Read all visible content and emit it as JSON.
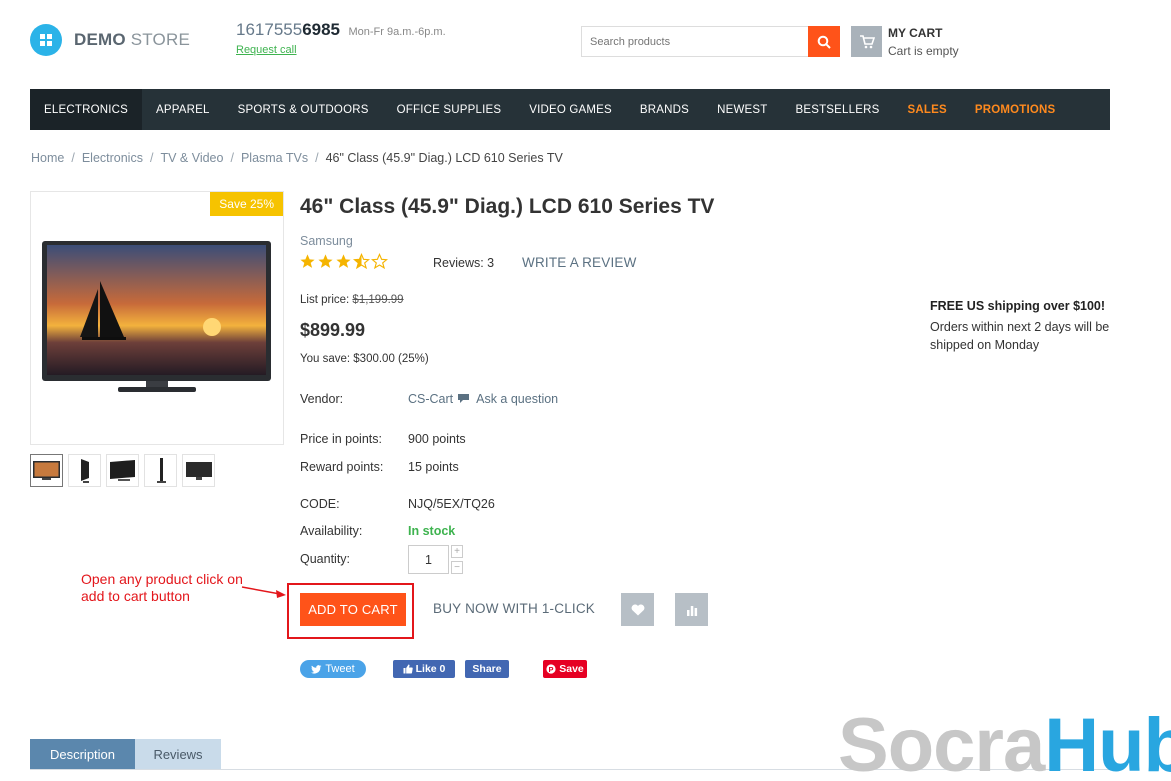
{
  "header": {
    "logo_bold": "DEMO",
    "logo_light": " STORE",
    "phone_prefix": "1617555",
    "phone_suffix": "6985",
    "hours": "Mon-Fr 9a.m.-6p.m.",
    "request_call": "Request call",
    "search_placeholder": "Search products",
    "cart_title": "MY CART",
    "cart_status": "Cart is empty"
  },
  "nav": {
    "items": [
      {
        "label": "ELECTRONICS"
      },
      {
        "label": "APPAREL"
      },
      {
        "label": "SPORTS & OUTDOORS"
      },
      {
        "label": "OFFICE SUPPLIES"
      },
      {
        "label": "VIDEO GAMES"
      },
      {
        "label": "BRANDS"
      },
      {
        "label": "NEWEST"
      },
      {
        "label": "BESTSELLERS"
      },
      {
        "label": "SALES"
      },
      {
        "label": "PROMOTIONS"
      }
    ]
  },
  "breadcrumb": {
    "items": [
      "Home",
      "Electronics",
      "TV & Video",
      "Plasma TVs"
    ],
    "current": "46\" Class (45.9\" Diag.) LCD 610 Series TV"
  },
  "product": {
    "save_badge": "Save 25%",
    "title": "46\" Class (45.9\" Diag.) LCD 610 Series TV",
    "brand": "Samsung",
    "rating": 3.5,
    "reviews_text": "Reviews: 3",
    "write_review": "WRITE A REVIEW",
    "list_price_label": "List price:",
    "list_price": "$1,199.99",
    "price": "$899.99",
    "you_save": "You save: $300.00 (25%)",
    "vendor_label": "Vendor:",
    "vendor": "CS-Cart",
    "ask_question": "Ask a question",
    "points_label": "Price in points:",
    "points": "900 points",
    "reward_label": "Reward points:",
    "reward": "15 points",
    "code_label": "CODE:",
    "code": "NJQ/5EX/TQ26",
    "availability_label": "Availability:",
    "availability": "In stock",
    "quantity_label": "Quantity:",
    "quantity": "1",
    "qty_plus": "+",
    "qty_minus": "−",
    "add_to_cart": "ADD TO CART",
    "buy_now": "BUY NOW WITH 1-CLICK"
  },
  "shipping": {
    "heading": "FREE US shipping over $100!",
    "text": "Orders within next 2 days will be shipped on Monday"
  },
  "annotation": {
    "text": "Open any product click on add to cart button",
    "color": "#e3161b"
  },
  "social": {
    "tweet": "Tweet",
    "like": "Like 0",
    "share": "Share",
    "save": "Save"
  },
  "tabs": {
    "description": "Description",
    "reviews": "Reviews"
  },
  "watermark": {
    "part1": "Socra",
    "part2": "Hub"
  },
  "colors": {
    "accent": "#ff5319",
    "nav_bg": "#263238",
    "link": "#5b7182",
    "in_stock": "#3eb34f",
    "badge": "#f6c300"
  }
}
